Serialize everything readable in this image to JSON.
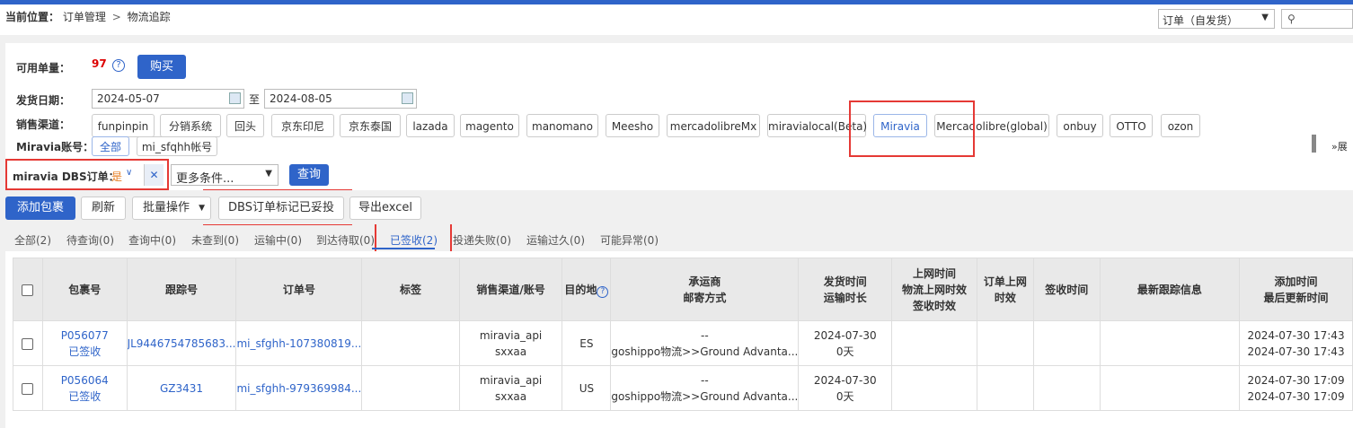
{
  "breadcrumb": {
    "label": "当前位置：",
    "items": [
      "订单管理",
      "物流追踪"
    ],
    "sep": ">"
  },
  "top": {
    "order_type": "订单（自发货）",
    "search_placeholder": ""
  },
  "quota": {
    "label": "可用单量：",
    "value": "97",
    "help": "?",
    "buy_label": "购买"
  },
  "ship_date": {
    "label": "发货日期：",
    "from": "2024-05-07",
    "to_word": "至",
    "to": "2024-08-05"
  },
  "channel": {
    "label": "销售渠道：",
    "items": [
      "funpinpin",
      "分销系统",
      "回头",
      "京东印尼",
      "京东泰国",
      "lazada",
      "magento",
      "manomano",
      "Meesho",
      "mercadolibreMx",
      "miravialocal(Beta)",
      "Miravia",
      "Mercadolibre(global)",
      "onbuy",
      "OTTO",
      "ozon"
    ],
    "selected": "Miravia",
    "expand_label": "展"
  },
  "account": {
    "label": "Miravia账号：",
    "items": [
      "全部",
      "mi_sfqhh帐号"
    ]
  },
  "dbs_filter": {
    "label": "miravia DBS订单：",
    "value": "是",
    "clear": "✕",
    "more_label": "更多条件...",
    "query_label": "查询"
  },
  "toolbar": {
    "add": "添加包裹",
    "refresh": "刷新",
    "batch": "批量操作",
    "dbs_mark": "DBS订单标记已妥投",
    "export": "导出excel"
  },
  "tabs": [
    "全部(2)",
    "待查询(0)",
    "查询中(0)",
    "未查到(0)",
    "运输中(0)",
    "到达待取(0)",
    "已签收(2)",
    "投递失败(0)",
    "运输过久(0)",
    "可能异常(0)"
  ],
  "active_tab": "已签收(2)",
  "table": {
    "headers": {
      "package": "包裹号",
      "tracking": "跟踪号",
      "order": "订单号",
      "tag": "标签",
      "channel": "销售渠道/账号",
      "dest": "目的地",
      "carrier": [
        "承运商",
        "邮寄方式"
      ],
      "ship_time": [
        "发货时间",
        "运输时长"
      ],
      "online": [
        "上网时间",
        "物流上网时效",
        "签收时效"
      ],
      "order_online": [
        "订单上网",
        "时效"
      ],
      "sign_time": "签收时间",
      "latest": "最新跟踪信息",
      "added": [
        "添加时间",
        "最后更新时间"
      ]
    },
    "rows": [
      {
        "package": "P056077",
        "status": "已签收",
        "tracking": "JL9446754785683...",
        "order": "mi_sfghh-107380819...",
        "tag": "",
        "channel": "miravia_api",
        "account": "sxxaa",
        "dest": "ES",
        "carrier": "--",
        "method": "goshippo物流>>Ground Advanta...",
        "ship_time": "2024-07-30",
        "duration": "0天",
        "online": "",
        "order_online": "",
        "sign_time": "",
        "latest": "",
        "added": "2024-07-30 17:43",
        "updated": "2024-07-30 17:43"
      },
      {
        "package": "P056064",
        "status": "已签收",
        "tracking": "GZ3431",
        "order": "mi_sfghh-979369984...",
        "tag": "",
        "channel": "miravia_api",
        "account": "sxxaa",
        "dest": "US",
        "carrier": "--",
        "method": "goshippo物流>>Ground Advanta...",
        "ship_time": "2024-07-30",
        "duration": "0天",
        "online": "",
        "order_online": "",
        "sign_time": "",
        "latest": "",
        "added": "2024-07-30 17:09",
        "updated": "2024-07-30 17:09"
      }
    ]
  },
  "colors": {
    "accent": "#2f64c9",
    "highlight_box": "#e53935",
    "quota": "#dd0000",
    "dbs_value": "#e67e22"
  }
}
